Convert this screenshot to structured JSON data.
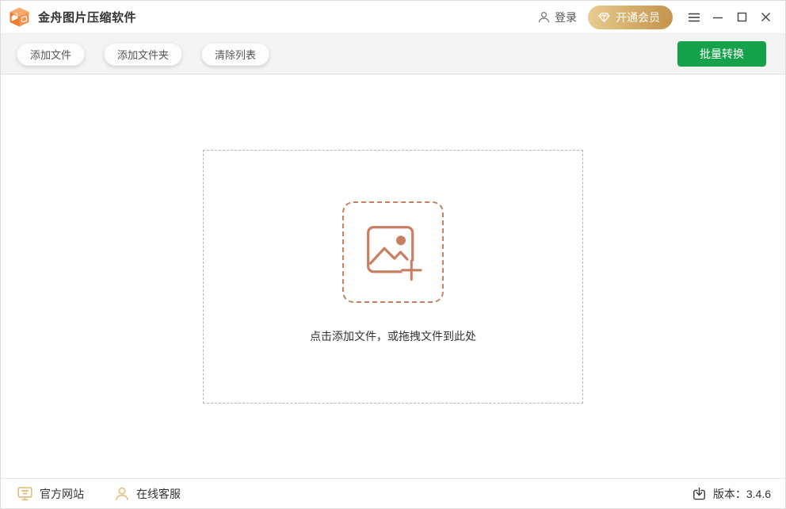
{
  "titlebar": {
    "app_title": "金舟图片压缩软件",
    "login_label": "登录",
    "vip_label": "开通会员"
  },
  "toolbar": {
    "add_file_label": "添加文件",
    "add_folder_label": "添加文件夹",
    "clear_list_label": "清除列表",
    "batch_convert_label": "批量转换"
  },
  "dropzone": {
    "hint": "点击添加文件，或拖拽文件到此处"
  },
  "footer": {
    "official_site_label": "官方网站",
    "online_support_label": "在线客服",
    "version_label": "版本：3.4.6"
  },
  "icons": {
    "app_logo": "orange-cube-with-photo",
    "login": "person-outline",
    "vip": "gem-outline",
    "menu": "hamburger-lines",
    "minimize": "dash",
    "maximize": "square",
    "close": "cross",
    "dropzone": "photo-with-plus",
    "official_site": "monitor",
    "online_support": "person-outline",
    "version": "box-arrow-down"
  },
  "colors": {
    "accent_green": "#15a24b",
    "vip_gold_start": "#e9cd92",
    "vip_gold_end": "#c4954e",
    "terracotta": "#c97f62",
    "footer_gold": "#e3bf80",
    "outer_dash": "#b5b5b5"
  }
}
